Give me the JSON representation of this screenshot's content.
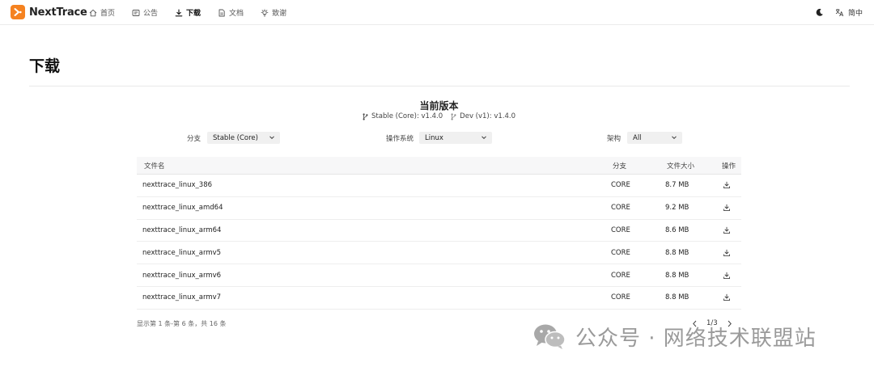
{
  "brand": {
    "name": "NextTrace"
  },
  "nav": {
    "items": [
      {
        "label": "首页",
        "icon": "home-icon"
      },
      {
        "label": "公告",
        "icon": "announcement-icon"
      },
      {
        "label": "下载",
        "icon": "download-icon",
        "active": true
      },
      {
        "label": "文档",
        "icon": "document-icon"
      },
      {
        "label": "致谢",
        "icon": "lightbulb-icon"
      }
    ],
    "language": "简中",
    "theme_icon": "moon-icon",
    "language_icon": "translate-icon"
  },
  "page": {
    "title": "下载",
    "version_heading": "当前版本",
    "versions": [
      {
        "label": "Stable (Core): v1.4.0",
        "icon": "branch-icon"
      },
      {
        "label": "Dev (v1): v1.4.0",
        "icon": "branch-icon"
      }
    ]
  },
  "filters": {
    "branch": {
      "label": "分支",
      "value": "Stable (Core)"
    },
    "os": {
      "label": "操作系统",
      "value": "Linux"
    },
    "arch": {
      "label": "架构",
      "value": "All"
    }
  },
  "table": {
    "headers": {
      "name": "文件名",
      "branch": "分支",
      "size": "文件大小",
      "action": "操作"
    },
    "rows": [
      {
        "name": "nexttrace_linux_386",
        "branch": "CORE",
        "size": "8.7 MB"
      },
      {
        "name": "nexttrace_linux_amd64",
        "branch": "CORE",
        "size": "9.2 MB"
      },
      {
        "name": "nexttrace_linux_arm64",
        "branch": "CORE",
        "size": "8.6 MB"
      },
      {
        "name": "nexttrace_linux_armv5",
        "branch": "CORE",
        "size": "8.8 MB"
      },
      {
        "name": "nexttrace_linux_armv6",
        "branch": "CORE",
        "size": "8.8 MB"
      },
      {
        "name": "nexttrace_linux_armv7",
        "branch": "CORE",
        "size": "8.8 MB"
      }
    ]
  },
  "pagination": {
    "summary": "显示第 1 条-第 6 条，共 16 条",
    "page_text": "1/3"
  },
  "watermark": {
    "text": "公众号 · 网络技术联盟站"
  },
  "colors": {
    "brand": "#f58220",
    "select_bg": "#f0f0f0",
    "header_bg": "#f7f7f8"
  }
}
